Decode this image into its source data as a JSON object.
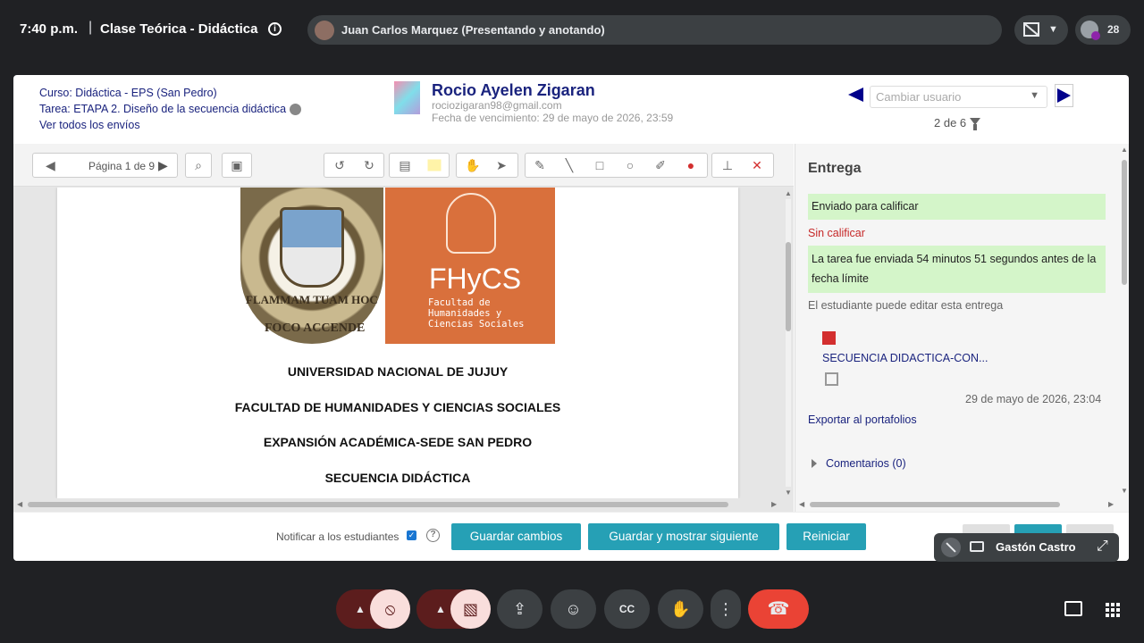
{
  "meet": {
    "time": "7:40 p.m.",
    "separator": "|",
    "title": "Clase Teórica - Didáctica",
    "presenter": "Juan Carlos Marquez (Presentando y anotando)",
    "participants": "28",
    "self_name": "Gastón Castro"
  },
  "header": {
    "course": "Curso: Didáctica - EPS (San Pedro)",
    "task": "Tarea: ETAPA 2. Diseño de la secuencia didáctica",
    "view_all": "Ver todos los envíos",
    "student_name": "Rocio Ayelen Zigaran",
    "student_email": "rociozigaran98@gmail.com",
    "due_date": "Fecha de vencimiento: 29 de mayo de 2026, 23:59",
    "change_user_placeholder": "Cambiar usuario",
    "user_count": "2 de 6"
  },
  "toolbar": {
    "page_label": "Página 1 de 9"
  },
  "document": {
    "seal_text_1": "FLAMMAM  TUAM  HOC",
    "seal_text_2": "FOCO ACCENDE",
    "logo": "FHyCS",
    "logo_sub_1": "Facultad de",
    "logo_sub_2": "Humanidades y",
    "logo_sub_3": "Ciencias Sociales",
    "line1": "UNIVERSIDAD NACIONAL DE JUJUY",
    "line2": "FACULTAD DE HUMANIDADES Y CIENCIAS SOCIALES",
    "line3": "EXPANSIÓN ACADÉMICA-SEDE SAN PEDRO",
    "line4": "SECUENCIA DIDÁCTICA"
  },
  "submission": {
    "title": "Entrega",
    "status": "Enviado para calificar",
    "grade_status": "Sin calificar",
    "timing": "La tarea fue enviada 54 minutos 51 segundos antes de la fecha límite",
    "editable": "El estudiante puede editar esta entrega",
    "file_name": "SECUENCIA DIDACTICA-CON...",
    "file_date": "29 de mayo de 2026, 23:04",
    "export": "Exportar al portafolios",
    "comments": "Comentarios (0)"
  },
  "actions": {
    "notify_label": "Notificar a los estudiantes",
    "save": "Guardar cambios",
    "save_next": "Guardar y mostrar siguiente",
    "reset": "Reiniciar"
  },
  "colors": {
    "teal": "#26a0b5",
    "meet_red": "#ea4335",
    "link": "#1a237e"
  }
}
